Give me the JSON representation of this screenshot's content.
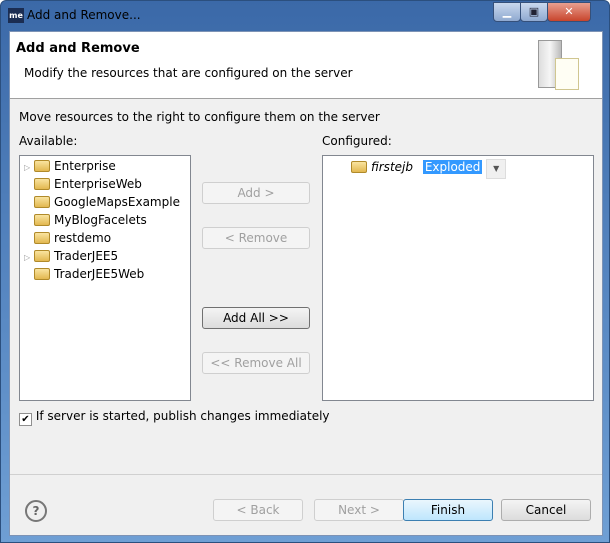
{
  "window": {
    "title": "Add and Remove...",
    "logo": "me"
  },
  "header": {
    "title": "Add and Remove",
    "description": "Modify the resources that are configured on the server"
  },
  "instruction": "Move resources to the right to configure them on the server",
  "available": {
    "label": "Available:",
    "items": [
      {
        "label": "Enterprise",
        "expandable": true
      },
      {
        "label": "EnterpriseWeb",
        "expandable": false
      },
      {
        "label": "GoogleMapsExample",
        "expandable": false
      },
      {
        "label": "MyBlogFacelets",
        "expandable": false
      },
      {
        "label": "restdemo",
        "expandable": false
      },
      {
        "label": "TraderJEE5",
        "expandable": true
      },
      {
        "label": "TraderJEE5Web",
        "expandable": false
      }
    ]
  },
  "configured": {
    "label": "Configured:",
    "items": [
      {
        "label": "firstejb",
        "mode": "Exploded"
      }
    ]
  },
  "buttons": {
    "add": "Add >",
    "remove": "< Remove",
    "add_all": "Add All >>",
    "remove_all": "<< Remove All",
    "back": "< Back",
    "next": "Next >",
    "finish": "Finish",
    "cancel": "Cancel"
  },
  "publish_checkbox": {
    "label": "If server is started, publish changes immediately",
    "checked": true
  },
  "help": "?"
}
